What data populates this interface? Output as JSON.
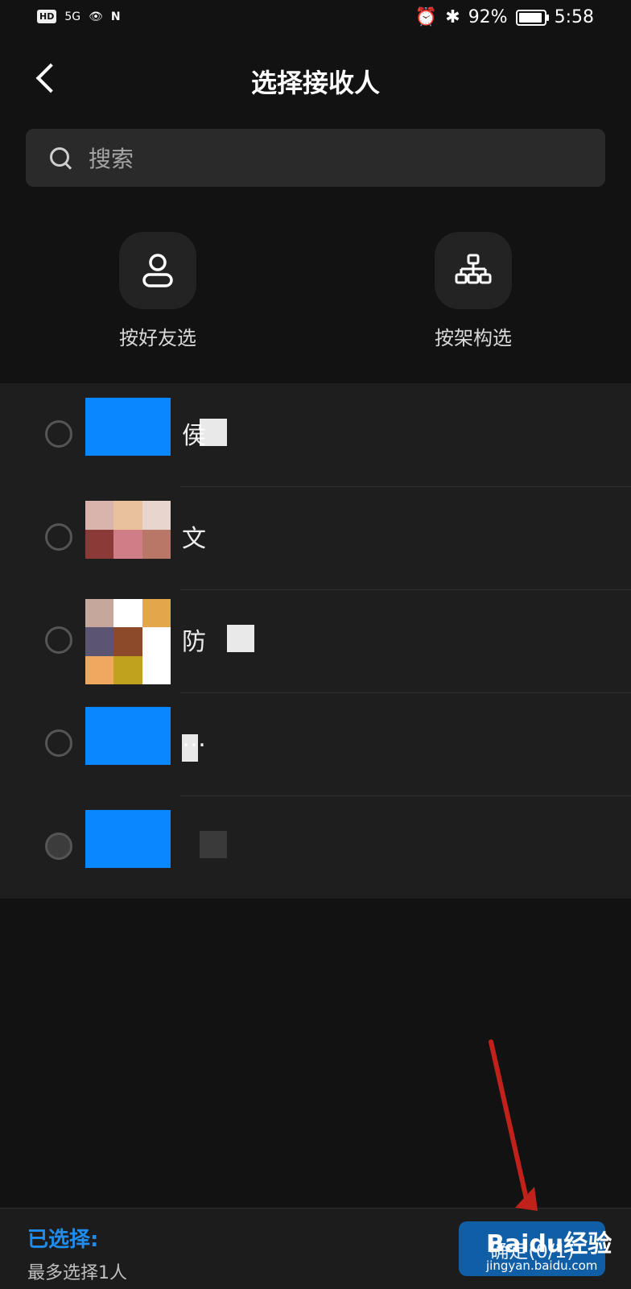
{
  "status_bar": {
    "network_badge": "HD",
    "signal": "5G",
    "battery_percent": "92%",
    "time": "5:58"
  },
  "header": {
    "title": "选择接收人"
  },
  "search": {
    "placeholder": "搜索"
  },
  "quick_select": [
    {
      "label": "按好友选",
      "icon": "person-icon"
    },
    {
      "label": "按架构选",
      "icon": "org-chart-icon"
    }
  ],
  "contacts": [
    {
      "name_visible": "侯",
      "avatar_colors": [
        "#0a86ff"
      ]
    },
    {
      "name_visible": "文",
      "avatar_colors": [
        "#d9b4ad",
        "#e9c19d",
        "#e8d5cd",
        "#8c3a37",
        "#cf7d86",
        "#b97767"
      ]
    },
    {
      "name_visible": "防",
      "avatar_colors": [
        "#c6a79b",
        "#ffffff",
        "#e4a64b",
        "#5b5572",
        "#8c4a2a",
        "#ffffff",
        "#f0a860",
        "#c1a21e",
        "#ffffff"
      ]
    },
    {
      "name_visible": "…",
      "avatar_colors": [
        "#0a86ff"
      ]
    },
    {
      "name_visible": "",
      "avatar_colors": [
        "#0a86ff"
      ]
    }
  ],
  "footer": {
    "selected_label": "已选择:",
    "max_label": "最多选择1人",
    "confirm_label": "确定(0/1)"
  },
  "watermark": {
    "brand": "Baidu经验",
    "url": "jingyan.baidu.com"
  },
  "colors": {
    "accent": "#1f8df0",
    "background": "#121212",
    "annotation_arrow": "#c0211b"
  }
}
